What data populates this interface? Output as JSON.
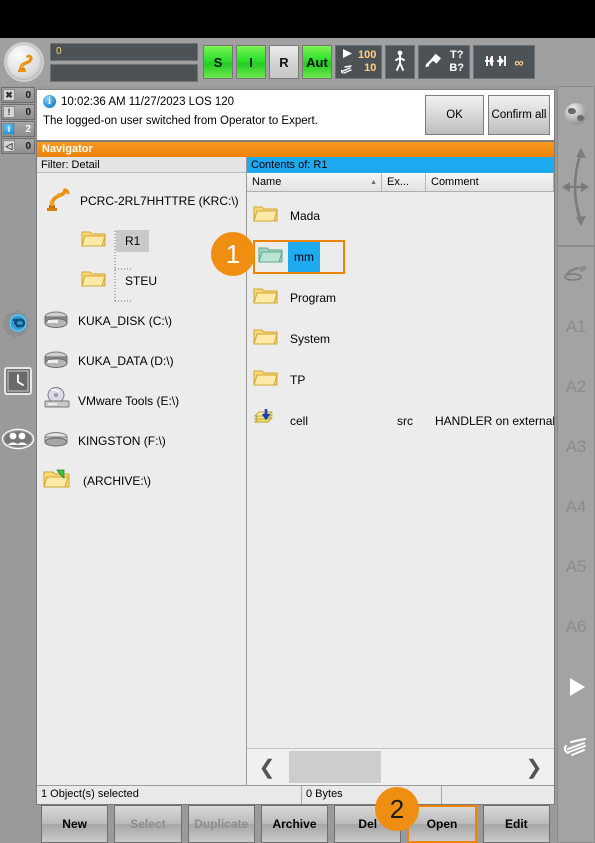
{
  "status_bar": {
    "robot_logo_icon": "kuka-robot-icon",
    "slider_value": "0",
    "mode_buttons": [
      {
        "label": "S",
        "state": "green",
        "name": "submit-interpreter-status"
      },
      {
        "label": "I",
        "state": "green",
        "name": "drives-status"
      },
      {
        "label": "R",
        "state": "grey",
        "name": "robot-interpreter-status"
      },
      {
        "label": "Aut",
        "state": "green",
        "name": "operating-mode"
      }
    ],
    "override_program": "100",
    "override_jog": "10",
    "program_run_icon": "play-triangle-icon",
    "jog_hand_icon": "hand-icon",
    "walking_icon": "walking-person-icon",
    "tool_icon": "tool-base-icon",
    "tool_label_top": "T?",
    "tool_label_bottom": "B?",
    "increment_icon": "increment-jog-icon",
    "increment_value": "∞"
  },
  "message": {
    "info_icon": "info-icon",
    "info_glyph": "i",
    "timestamp_line": "10:02:36 AM 11/27/2023 LOS 120",
    "body": "The logged-on user switched from Operator to Expert.",
    "ok_label": "OK",
    "confirm_all_label": "Confirm all"
  },
  "navigator": {
    "title": "Navigator",
    "filter_label": "Filter: Detail",
    "tree": [
      {
        "label": "PCRC-2RL7HHTTRE (KRC:\\)",
        "icon": "robot-icon",
        "level": 0,
        "selected": false
      },
      {
        "label": "R1",
        "icon": "folder-icon",
        "level": 1,
        "selected": true
      },
      {
        "label": "STEU",
        "icon": "folder-icon",
        "level": 1,
        "selected": false
      },
      {
        "label": "KUKA_DISK (C:\\)",
        "icon": "harddisk-icon",
        "level": 0,
        "selected": false
      },
      {
        "label": "KUKA_DATA (D:\\)",
        "icon": "harddisk-icon",
        "level": 0,
        "selected": false
      },
      {
        "label": "VMware Tools (E:\\)",
        "icon": "cdrom-icon",
        "level": 0,
        "selected": false
      },
      {
        "label": "KINGSTON (F:\\)",
        "icon": "usbdrive-icon",
        "level": 0,
        "selected": false
      },
      {
        "label": "(ARCHIVE:\\)",
        "icon": "archive-folder-icon",
        "level": 0,
        "selected": false
      }
    ],
    "contents_header": "Contents of: R1",
    "columns": [
      {
        "label": "Name",
        "sort_icon": "sort-ascending-caret"
      },
      {
        "label": "Ex...",
        "sort_icon": ""
      },
      {
        "label": "Comment",
        "sort_icon": ""
      }
    ],
    "files": [
      {
        "name": "Mada",
        "ext": "",
        "comment": "",
        "icon": "folder-icon",
        "selected": false
      },
      {
        "name": "mm",
        "ext": "",
        "comment": "",
        "icon": "folder-open-icon",
        "selected": true
      },
      {
        "name": "Program",
        "ext": "",
        "comment": "",
        "icon": "folder-icon",
        "selected": false
      },
      {
        "name": "System",
        "ext": "",
        "comment": "",
        "icon": "folder-icon",
        "selected": false
      },
      {
        "name": "TP",
        "ext": "",
        "comment": "",
        "icon": "folder-icon",
        "selected": false
      },
      {
        "name": "cell",
        "ext": "src",
        "comment": "HANDLER on external .",
        "icon": "src-module-icon",
        "selected": false
      }
    ],
    "scroll_left_icon": "chevron-left-icon",
    "scroll_right_icon": "chevron-right-icon",
    "status_selected": "1 Object(s) selected",
    "status_size": "0 Bytes",
    "status_extra": ""
  },
  "buttons": [
    {
      "label": "New",
      "disabled": false,
      "highlighted": false
    },
    {
      "label": "Select",
      "disabled": true,
      "highlighted": false
    },
    {
      "label": "Duplicate",
      "disabled": true,
      "highlighted": false
    },
    {
      "label": "Archive",
      "disabled": false,
      "highlighted": false
    },
    {
      "label": "Del",
      "disabled": false,
      "highlighted": false
    },
    {
      "label": "Open",
      "disabled": false,
      "highlighted": true
    },
    {
      "label": "Edit",
      "disabled": false,
      "highlighted": false
    }
  ],
  "left_sidebar": {
    "counters": [
      {
        "icon": "acknowledge-message-icon",
        "glyph": "✖",
        "count": "0",
        "kind": "plain"
      },
      {
        "icon": "state-message-icon",
        "glyph": "!",
        "count": "0",
        "kind": "plain"
      },
      {
        "icon": "notification-message-icon",
        "glyph": "i",
        "count": "2",
        "kind": "blue"
      },
      {
        "icon": "waiting-message-icon",
        "glyph": "◁",
        "count": "0",
        "kind": "plain"
      }
    ],
    "icons": [
      {
        "name": "robot-interpreter-gear-icon"
      },
      {
        "name": "clock-icon"
      },
      {
        "name": "user-group-icon"
      }
    ],
    "battery_icon": "battery-indicator"
  },
  "right_sidebar": {
    "world_icon": "world-coordinate-icon",
    "motion_icon": "jog-direction-icon",
    "tcp_icon": "tool-coordinate-icon",
    "axes": [
      "A1",
      "A2",
      "A3",
      "A4",
      "A5",
      "A6"
    ],
    "play_icon": "play-triangle-icon",
    "hand_icon": "jog-hand-icon"
  },
  "badges": [
    {
      "number": "1",
      "target": "selected-file-mm"
    },
    {
      "number": "2",
      "target": "open-button"
    }
  ],
  "colors": {
    "accent_orange": "#ef8307",
    "badge_orange": "#ef8e10",
    "selection_blue": "#1eaaf1",
    "green_status": "#2ee02e",
    "chrome_grey": "#9a9a9a"
  }
}
